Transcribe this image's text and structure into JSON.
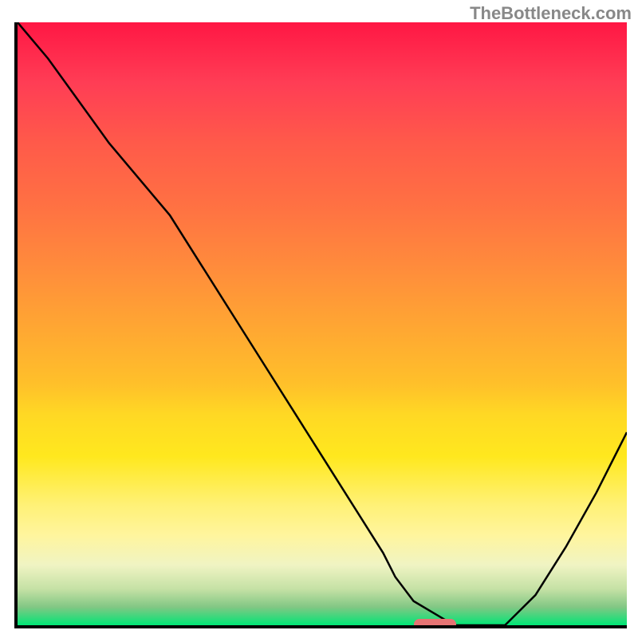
{
  "watermark": "TheBottleneck.com",
  "chart_data": {
    "type": "line",
    "title": "",
    "xlabel": "",
    "ylabel": "",
    "xlim": [
      0,
      100
    ],
    "ylim": [
      0,
      100
    ],
    "x": [
      0,
      5,
      10,
      15,
      20,
      25,
      30,
      35,
      40,
      45,
      50,
      55,
      60,
      62,
      65,
      70,
      72,
      75,
      80,
      85,
      90,
      95,
      100
    ],
    "values": [
      100,
      94,
      87,
      80,
      74,
      68,
      60,
      52,
      44,
      36,
      28,
      20,
      12,
      8,
      4,
      1,
      0,
      0,
      0,
      5,
      13,
      22,
      32
    ],
    "gradient_stops": [
      {
        "pos": 0,
        "color": "#ff1744"
      },
      {
        "pos": 50,
        "color": "#ffa533"
      },
      {
        "pos": 75,
        "color": "#fff176"
      },
      {
        "pos": 100,
        "color": "#00e676"
      }
    ],
    "marker": {
      "x_start": 65,
      "x_end": 72,
      "y": 0,
      "color": "#e57373"
    },
    "grid": false
  }
}
